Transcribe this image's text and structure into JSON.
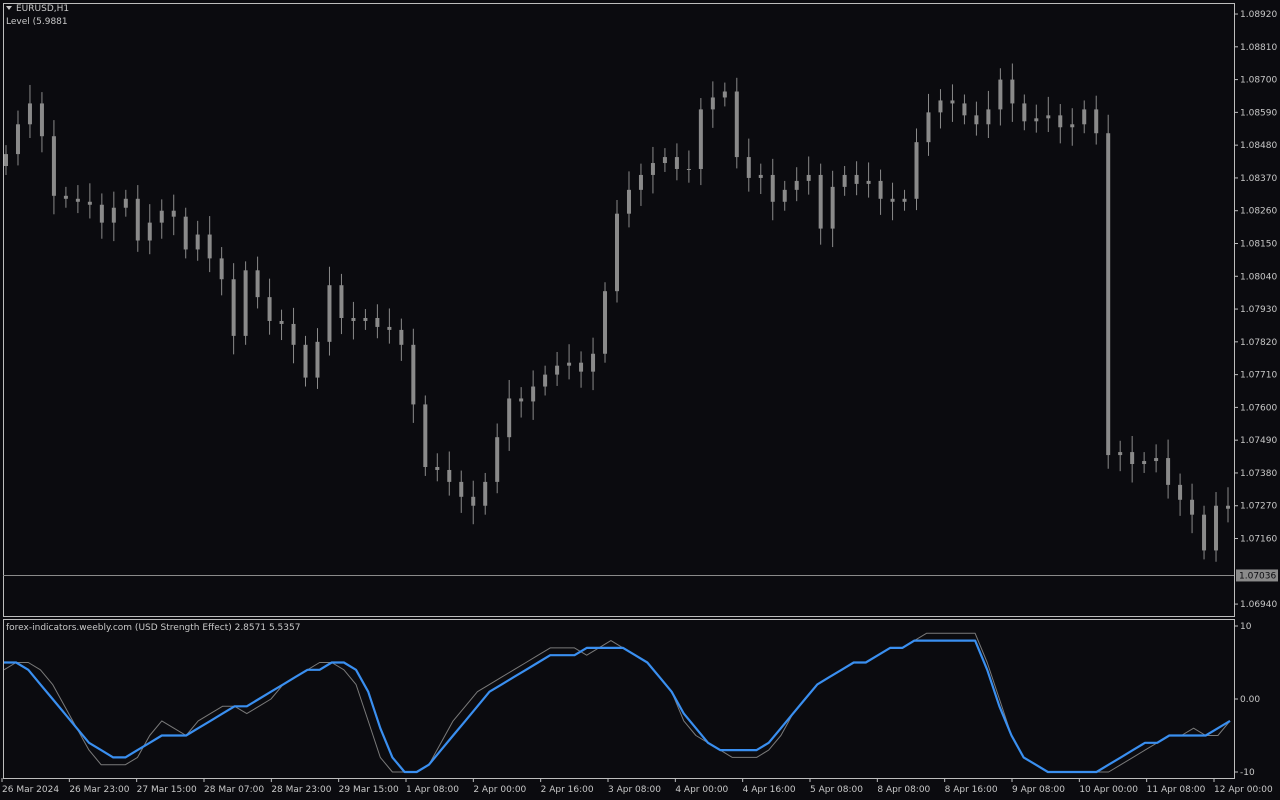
{
  "header": {
    "symbol": "EURUSD,H1",
    "level_label": "Level (5.9881"
  },
  "indicator": {
    "label": "forex-indicators.weebly.com (USD Strength Effect) 2.8571 5.5357"
  },
  "colors": {
    "background": "#0b0b0f",
    "grid_frame": "#bdbdbd",
    "candle": "#8a8a8a",
    "strength_line": "#3a8ff0",
    "raw_line": "#7a7a7a"
  },
  "price_axis": {
    "ticks": [
      "1.08920",
      "1.08810",
      "1.08700",
      "1.08590",
      "1.08480",
      "1.08370",
      "1.08260",
      "1.08150",
      "1.08040",
      "1.07930",
      "1.07820",
      "1.07710",
      "1.07600",
      "1.07490",
      "1.07380",
      "1.07270",
      "1.07160",
      "1.06940"
    ],
    "current_price": "1.07036"
  },
  "indicator_axis": {
    "ticks": [
      "10",
      "0.00",
      "-10"
    ]
  },
  "time_axis": {
    "labels": [
      "26 Mar 2024",
      "26 Mar 23:00",
      "27 Mar 15:00",
      "28 Mar 07:00",
      "28 Mar 23:00",
      "29 Mar 15:00",
      "1 Apr 08:00",
      "2 Apr 00:00",
      "2 Apr 16:00",
      "3 Apr 08:00",
      "4 Apr 00:00",
      "4 Apr 16:00",
      "5 Apr 08:00",
      "8 Apr 08:00",
      "8 Apr 16:00",
      "9 Apr 08:00",
      "10 Apr 00:00",
      "11 Apr 08:00",
      "12 Apr 00:00"
    ]
  },
  "chart_data": [
    {
      "type": "candlestick",
      "title": "EURUSD,H1",
      "ylim": [
        1.069,
        1.0895
      ],
      "current_price": 1.07036,
      "closes": [
        1.0845,
        1.0855,
        1.0862,
        1.0851,
        1.0831,
        1.083,
        1.0829,
        1.0828,
        1.0822,
        1.0827,
        1.083,
        1.0816,
        1.0822,
        1.0826,
        1.0824,
        1.0813,
        1.0818,
        1.081,
        1.0803,
        1.0784,
        1.0806,
        1.0797,
        1.0789,
        1.0788,
        1.0781,
        1.077,
        1.0782,
        1.0801,
        1.079,
        1.0789,
        1.079,
        1.0787,
        1.0786,
        1.0781,
        1.0761,
        1.074,
        1.0739,
        1.0735,
        1.073,
        1.0727,
        1.0735,
        1.075,
        1.0763,
        1.0762,
        1.0767,
        1.0771,
        1.0774,
        1.0775,
        1.0772,
        1.0778,
        1.0799,
        1.0825,
        1.0833,
        1.0838,
        1.0842,
        1.0844,
        1.084,
        1.084,
        1.086,
        1.0864,
        1.0866,
        1.0844,
        1.0837,
        1.0838,
        1.0829,
        1.0833,
        1.0836,
        1.0838,
        1.082,
        1.0834,
        1.0838,
        1.0835,
        1.0836,
        1.083,
        1.0829,
        1.083,
        1.0849,
        1.0859,
        1.0863,
        1.0862,
        1.0858,
        1.0855,
        1.086,
        1.087,
        1.0862,
        1.0856,
        1.0857,
        1.0858,
        1.0854,
        1.0855,
        1.086,
        1.0852,
        1.0744,
        1.0745,
        1.0741,
        1.0742,
        1.0743,
        1.0734,
        1.0729,
        1.0724,
        1.0712,
        1.0727,
        1.0726
      ]
    },
    {
      "type": "line",
      "title": "USD Strength Effect",
      "ylim": [
        -10,
        10
      ],
      "series": [
        {
          "name": "2.8571",
          "values": [
            4,
            5,
            5,
            4,
            2,
            -1,
            -4,
            -7,
            -9,
            -9,
            -9,
            -8,
            -5,
            -3,
            -4,
            -5,
            -3,
            -2,
            -1,
            -1,
            -2,
            -1,
            0,
            2,
            3,
            4,
            5,
            5,
            4,
            2,
            -3,
            -8,
            -10,
            -10,
            -10,
            -9,
            -6,
            -3,
            -1,
            1,
            2,
            3,
            4,
            5,
            6,
            7,
            7,
            7,
            6,
            7,
            8,
            7,
            6,
            5,
            3,
            1,
            -3,
            -5,
            -6,
            -7,
            -8,
            -8,
            -8,
            -7,
            -5,
            -2,
            0,
            2,
            3,
            4,
            5,
            5,
            6,
            7,
            7,
            8,
            9,
            9,
            9,
            9,
            9,
            5,
            0,
            -5,
            -8,
            -9,
            -10,
            -10,
            -10,
            -10,
            -10,
            -10,
            -9,
            -8,
            -7,
            -6,
            -5,
            -5,
            -4,
            -5,
            -5,
            -3
          ]
        },
        {
          "name": "5.5357",
          "values": [
            5,
            5,
            4,
            2,
            0,
            -2,
            -4,
            -6,
            -7,
            -8,
            -8,
            -7,
            -6,
            -5,
            -5,
            -5,
            -4,
            -3,
            -2,
            -1,
            -1,
            0,
            1,
            2,
            3,
            4,
            4,
            5,
            5,
            4,
            1,
            -4,
            -8,
            -10,
            -10,
            -9,
            -7,
            -5,
            -3,
            -1,
            1,
            2,
            3,
            4,
            5,
            6,
            6,
            6,
            7,
            7,
            7,
            7,
            6,
            5,
            3,
            1,
            -2,
            -4,
            -6,
            -7,
            -7,
            -7,
            -7,
            -6,
            -4,
            -2,
            0,
            2,
            3,
            4,
            5,
            5,
            6,
            7,
            7,
            8,
            8,
            8,
            8,
            8,
            8,
            4,
            -1,
            -5,
            -8,
            -9,
            -10,
            -10,
            -10,
            -10,
            -10,
            -9,
            -8,
            -7,
            -6,
            -6,
            -5,
            -5,
            -5,
            -5,
            -4,
            -3
          ]
        }
      ]
    }
  ]
}
